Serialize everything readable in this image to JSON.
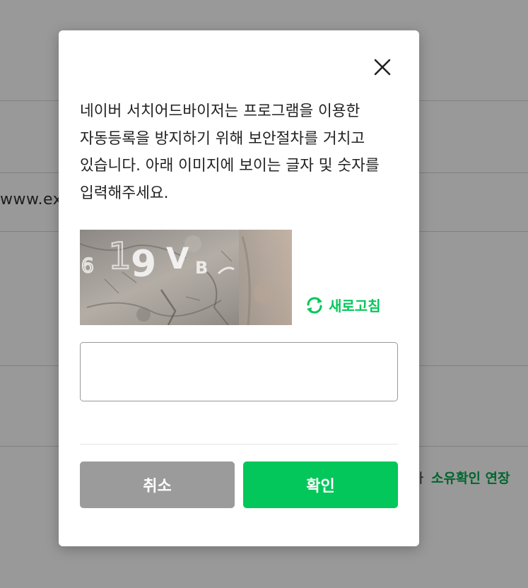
{
  "background": {
    "url_text": "www.exa",
    "fragment_text": "가",
    "extend_link": "소유확인 연장"
  },
  "dialog": {
    "close_icon": "close-icon",
    "message": "네이버 서치어드바이저는 프로그램을 이용한 자동등록을 방지하기 위해 보안절차를 거치고 있습니다. 아래 이미지에 보이는 글자 및 숫자를 입력해주세요.",
    "captcha": {
      "characters": "619VB"
    },
    "refresh": {
      "icon": "refresh-icon",
      "label": "새로고침"
    },
    "answer_input": {
      "value": "",
      "placeholder": ""
    },
    "buttons": {
      "cancel": "취소",
      "confirm": "확인"
    }
  },
  "colors": {
    "accent": "#03c75a",
    "cancel": "#9b9b9b",
    "link": "#03a94d"
  }
}
